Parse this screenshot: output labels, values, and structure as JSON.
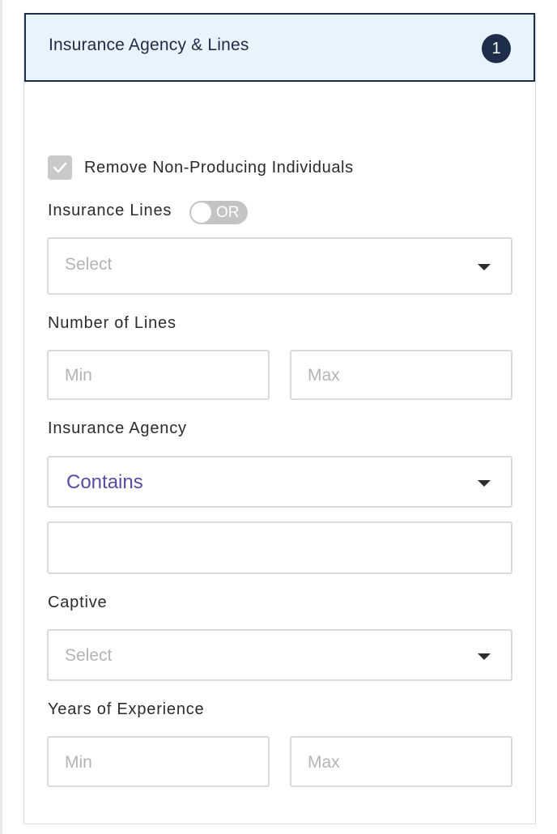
{
  "panel": {
    "title": "Insurance Agency & Lines",
    "badge_count": "1"
  },
  "remove_non_producing": {
    "label": "Remove Non-Producing Individuals",
    "checked": true
  },
  "insurance_lines": {
    "label": "Insurance Lines",
    "toggle_text": "OR",
    "select_placeholder": "Select"
  },
  "number_of_lines": {
    "label": "Number of Lines",
    "min_placeholder": "Min",
    "max_placeholder": "Max"
  },
  "insurance_agency": {
    "label": "Insurance Agency",
    "operator_value": "Contains",
    "text_value": ""
  },
  "captive": {
    "label": "Captive",
    "select_placeholder": "Select"
  },
  "years_of_experience": {
    "label": "Years of Experience",
    "min_placeholder": "Min",
    "max_placeholder": "Max"
  },
  "colors": {
    "header_bg": "#e8f4fd",
    "header_border": "#1e2d4a",
    "badge_bg": "#1e2d4a",
    "selected_text": "#5a4aa6"
  },
  "icons": {
    "checkbox_mark": "checkmark-icon",
    "dropdown": "chevron-down-icon"
  }
}
